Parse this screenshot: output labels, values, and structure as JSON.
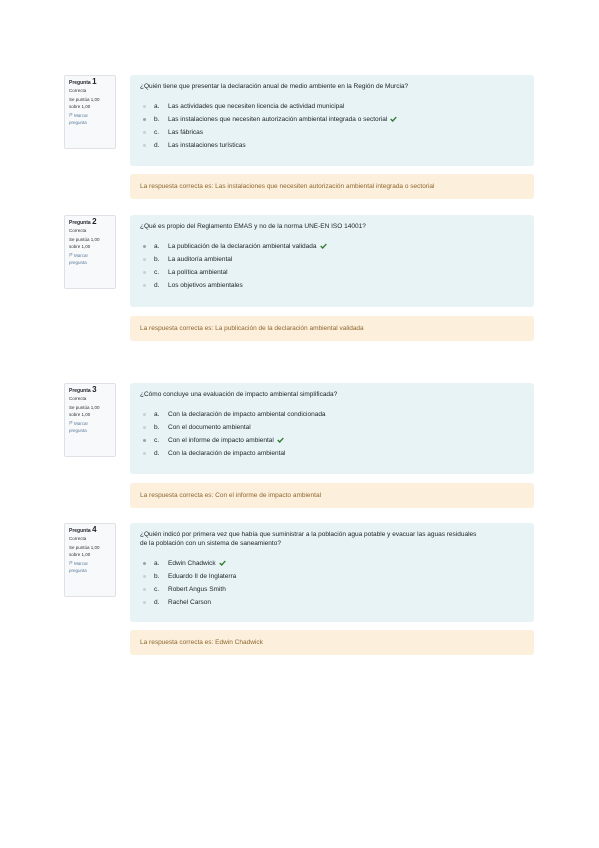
{
  "colors": {
    "formulation_bg": "#e7f3f5",
    "feedback_bg": "#fcefdc",
    "feedback_text": "#8e662e",
    "correct_check": "#357a32",
    "info_border": "#dee2e6"
  },
  "questions": [
    {
      "label": "Pregunta",
      "number": "1",
      "state": "Correcta",
      "grade_line1": "Se puntúa 1,00",
      "grade_line2": "sobre 1,00",
      "flag_line1": "Marcar",
      "flag_line2": "pregunta",
      "text": "¿Quién tiene que presentar la declaración anual de medio ambiente en la Región de Murcia?",
      "answers": [
        {
          "letter": "a.",
          "text": "Las actividades que necesiten licencia de actividad municipal",
          "selected": false,
          "correct": false
        },
        {
          "letter": "b.",
          "text": "Las instalaciones que necesiten autorización ambiental integrada o sectorial",
          "selected": true,
          "correct": true
        },
        {
          "letter": "c.",
          "text": "Las fábricas",
          "selected": false,
          "correct": false
        },
        {
          "letter": "d.",
          "text": "Las instalaciones turísticas",
          "selected": false,
          "correct": false
        }
      ],
      "feedback": "La respuesta correcta es: Las instalaciones que necesiten autorización ambiental integrada o sectorial"
    },
    {
      "label": "Pregunta",
      "number": "2",
      "state": "Correcta",
      "grade_line1": "Se puntúa 1,00",
      "grade_line2": "sobre 1,00",
      "flag_line1": "Marcar",
      "flag_line2": "pregunta",
      "text": "¿Qué es propio del Reglamento EMAS y no de la norma UNE-EN ISO 14001?",
      "answers": [
        {
          "letter": "a.",
          "text": "La publicación de la declaración ambiental validada",
          "selected": true,
          "correct": true
        },
        {
          "letter": "b.",
          "text": "La auditoría ambiental",
          "selected": false,
          "correct": false
        },
        {
          "letter": "c.",
          "text": "La política ambiental",
          "selected": false,
          "correct": false
        },
        {
          "letter": "d.",
          "text": "Los objetivos ambientales",
          "selected": false,
          "correct": false
        }
      ],
      "feedback": "La respuesta correcta es: La publicación de la declaración ambiental validada"
    },
    {
      "label": "Pregunta",
      "number": "3",
      "state": "Correcta",
      "grade_line1": "Se puntúa 1,00",
      "grade_line2": "sobre 1,00",
      "flag_line1": "Marcar",
      "flag_line2": "pregunta",
      "text": "¿Cómo concluye una evaluación de impacto ambiental simplificada?",
      "answers": [
        {
          "letter": "a.",
          "text": "Con la declaración de impacto ambiental condicionada",
          "selected": false,
          "correct": false
        },
        {
          "letter": "b.",
          "text": "Con el documento ambiental",
          "selected": false,
          "correct": false
        },
        {
          "letter": "c.",
          "text": "Con el informe de impacto ambiental",
          "selected": true,
          "correct": true
        },
        {
          "letter": "d.",
          "text": "Con la declaración de impacto ambiental",
          "selected": false,
          "correct": false
        }
      ],
      "feedback": "La respuesta correcta es: Con el informe de impacto ambiental"
    },
    {
      "label": "Pregunta",
      "number": "4",
      "state": "Correcta",
      "grade_line1": "Se puntúa 1,00",
      "grade_line2": "sobre 1,00",
      "flag_line1": "Marcar",
      "flag_line2": "pregunta",
      "text_line1": "¿Quién indicó por primera vez que había que suministrar a la población agua potable y evacuar las aguas residuales",
      "text_line2": "de la población con un sistema de saneamiento?",
      "answers": [
        {
          "letter": "a.",
          "text": "Edwin Chadwick",
          "selected": true,
          "correct": true
        },
        {
          "letter": "b.",
          "text": "Eduardo II de Inglaterra",
          "selected": false,
          "correct": false
        },
        {
          "letter": "c.",
          "text": "Robert Angus Smith",
          "selected": false,
          "correct": false
        },
        {
          "letter": "d.",
          "text": "Rachel Carson",
          "selected": false,
          "correct": false
        }
      ],
      "feedback": "La respuesta correcta es: Edwin Chadwick"
    }
  ]
}
